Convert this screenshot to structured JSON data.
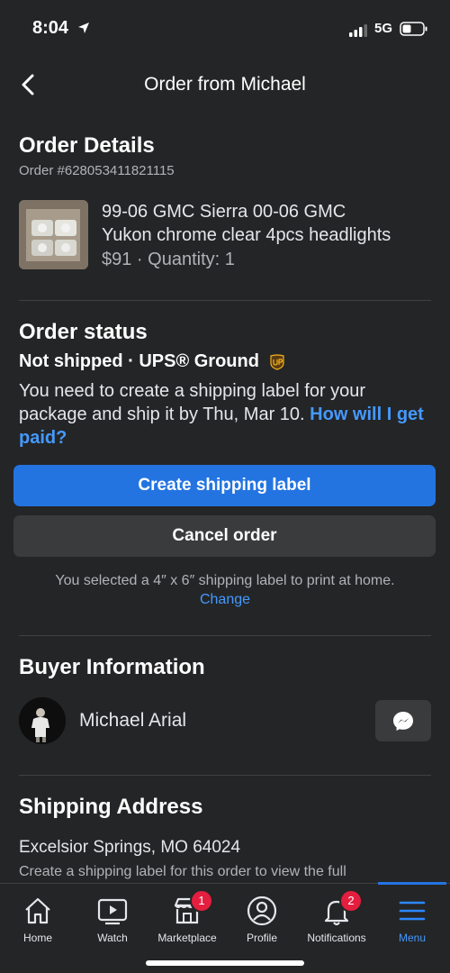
{
  "status_bar": {
    "time": "8:04",
    "network": "5G"
  },
  "header": {
    "title": "Order from Michael"
  },
  "order_details": {
    "title": "Order Details",
    "order_number": "Order #628053411821115",
    "item_title_line1": "99-06 GMC Sierra 00-06 GMC",
    "item_title_line2": "Yukon chrome clear 4pcs headlights",
    "item_price_qty": "$91 · Quantity: 1"
  },
  "order_status": {
    "title": "Order status",
    "status": "Not shipped · UPS® Ground",
    "description": "You need to create a shipping label for your package and ship it by Thu, Mar 10. ",
    "link": "How will I get paid?",
    "create_label_button": "Create shipping label",
    "cancel_button": "Cancel order",
    "label_note": "You selected a 4″ x 6″ shipping label to print at home.",
    "change_link": "Change"
  },
  "buyer": {
    "title": "Buyer Information",
    "name": "Michael Arial"
  },
  "shipping": {
    "title": "Shipping Address",
    "address": "Excelsior Springs, MO 64024",
    "note": "Create a shipping label for this order to view the full"
  },
  "tabs": [
    {
      "label": "Home",
      "icon": "home-icon",
      "badge": ""
    },
    {
      "label": "Watch",
      "icon": "watch-icon",
      "badge": ""
    },
    {
      "label": "Marketplace",
      "icon": "marketplace-icon",
      "badge": "1"
    },
    {
      "label": "Profile",
      "icon": "profile-icon",
      "badge": ""
    },
    {
      "label": "Notifications",
      "icon": "bell-icon",
      "badge": "2"
    },
    {
      "label": "Menu",
      "icon": "menu-icon",
      "badge": "",
      "active": true
    }
  ],
  "colors": {
    "background": "#242526",
    "accent": "#2374e1",
    "link": "#4599ff",
    "badge": "#e41e3f",
    "button_secondary": "#3a3b3c"
  }
}
